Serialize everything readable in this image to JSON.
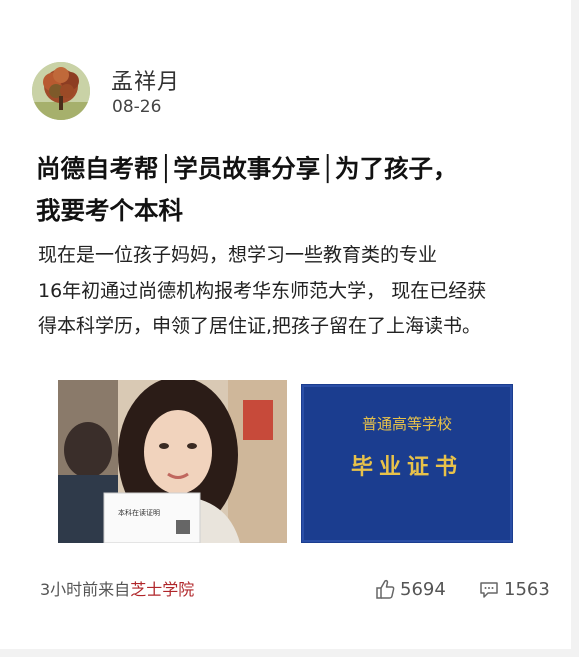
{
  "author": {
    "name": "孟祥月",
    "date": "08-26",
    "avatar_icon": "tree-avatar"
  },
  "post": {
    "title_line1": "尚德自考帮│学员故事分享│为了孩子，",
    "title_line2": "我要考个本科",
    "body_lines": [
      "现在是一位孩子妈妈，想学习一些教育类的专业",
      "16年初通过尚德机构报考华东师范大学， 现在已经获",
      "得本科学历，申领了居住证,把孩子留在了上海读书。"
    ],
    "images": {
      "photo_caption": "本科在读证明",
      "diploma_top": "普通高等学校",
      "diploma_main": "毕业证书"
    }
  },
  "footer": {
    "time_prefix": "3小时前来自",
    "source_name": "芝士学院",
    "likes": "5694",
    "comments": "1563",
    "like_icon": "thumbs-up-icon",
    "comment_icon": "comment-icon"
  },
  "colors": {
    "brand_red": "#b0262a",
    "diploma_blue": "#1b3d8f",
    "diploma_gold": "#e8c24a"
  }
}
